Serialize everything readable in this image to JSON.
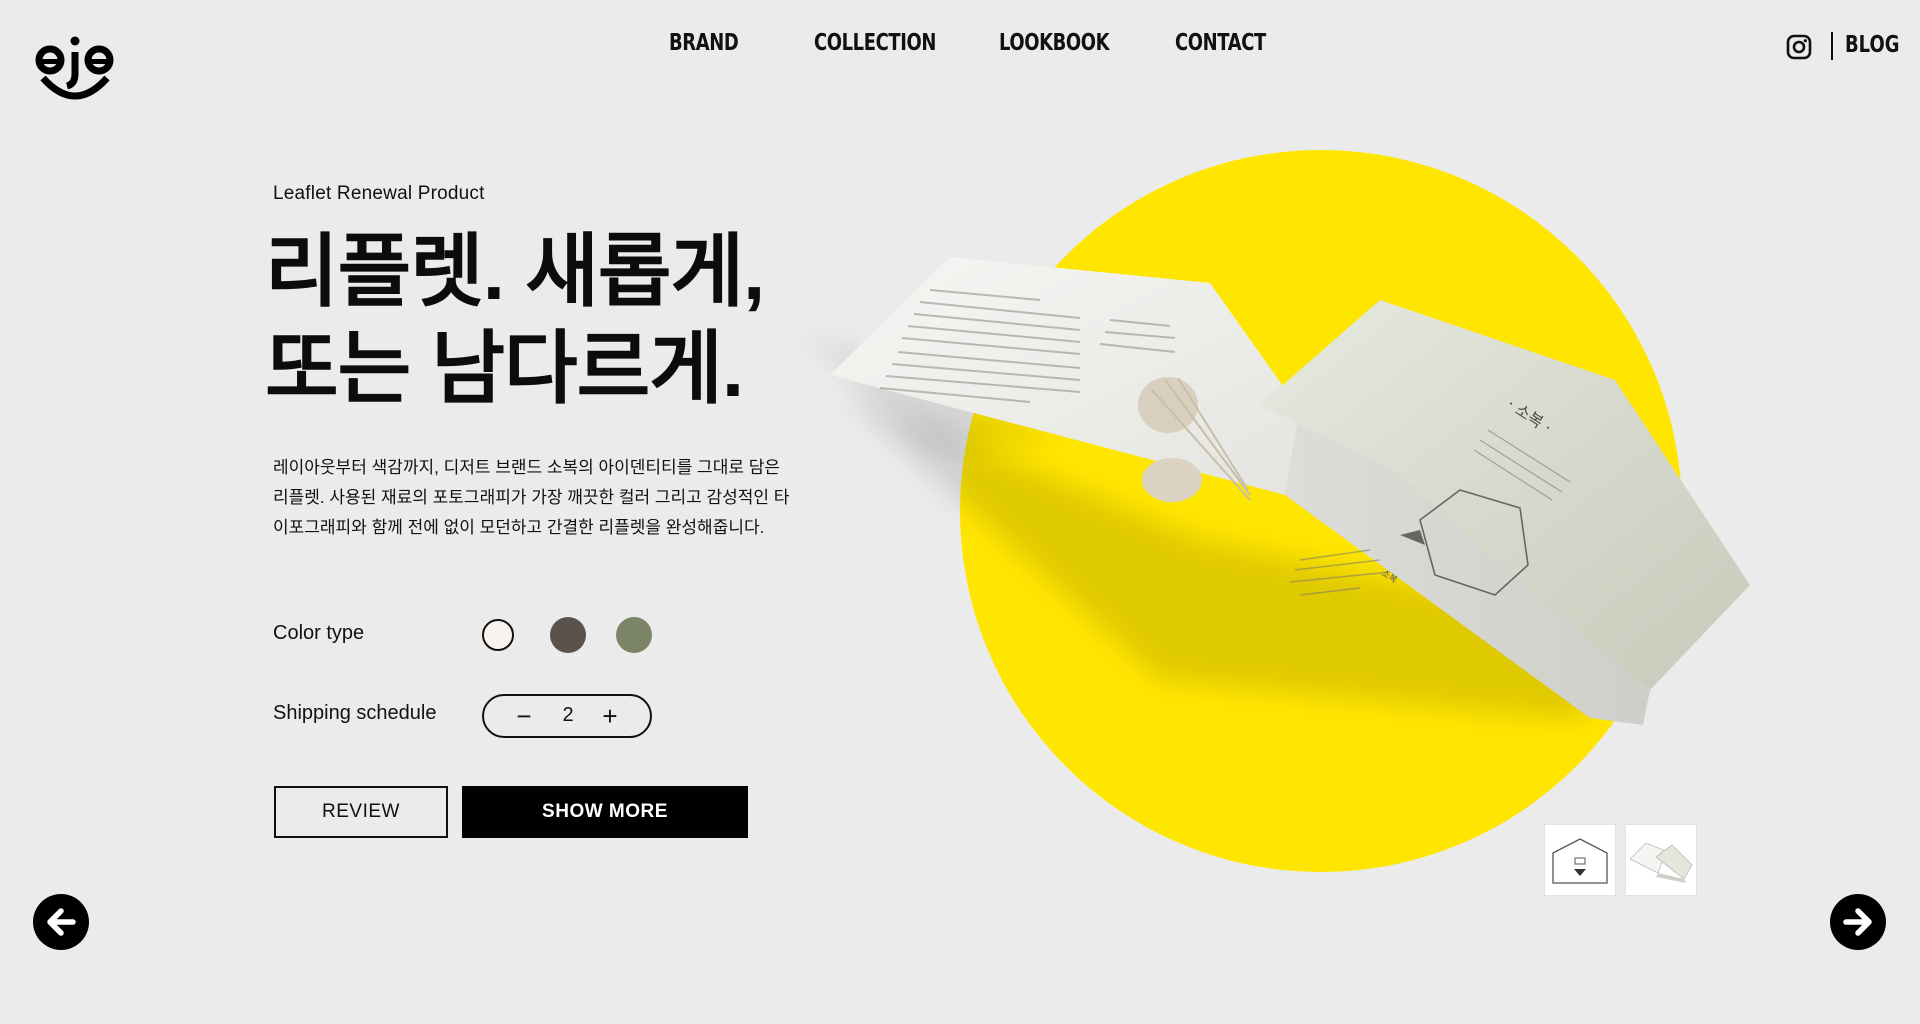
{
  "header": {
    "logo_text": "eje",
    "nav": [
      "BRAND",
      "COLLECTION",
      "LOOKBOOK",
      "CONTACT"
    ],
    "blog_label": "BLOG",
    "social_icon": "instagram-icon"
  },
  "hero": {
    "eyebrow": "Leaflet Renewal Product",
    "headline_line1": "리플렛. 새롭게,",
    "headline_line2": "또는 남다르게.",
    "description": "레이아웃부터 색감까지, 디저트 브랜드 소복의 아이덴티티를 그대로 담은 리플렛. 사용된 재료의 포토그래피가 가장 깨끗한 컬러 그리고 감성적인 타이포그래피와 함께 전에 없이 모던하고 간결한 리플렛을 완성해줍니다."
  },
  "color_type": {
    "label": "Color type",
    "swatches": [
      "#f8f3ee",
      "#5a524d",
      "#7b8467"
    ]
  },
  "shipping": {
    "label": "Shipping schedule",
    "value": "2",
    "minus": "−",
    "plus": "+"
  },
  "buttons": {
    "review": "REVIEW",
    "show_more": "SHOW MORE"
  },
  "leaflet": {
    "brand_kr": "소복",
    "panel_title": "ㆍ소복ㆍ",
    "panel_sub": "소복, 자연의 맛을 위한 건강한 디저트"
  },
  "colors": {
    "background": "#ebebeb",
    "accent_yellow": "#ffe600",
    "ink": "#000000"
  },
  "icons": {
    "prev": "arrow-left-circle-icon",
    "next": "arrow-right-circle-icon"
  }
}
